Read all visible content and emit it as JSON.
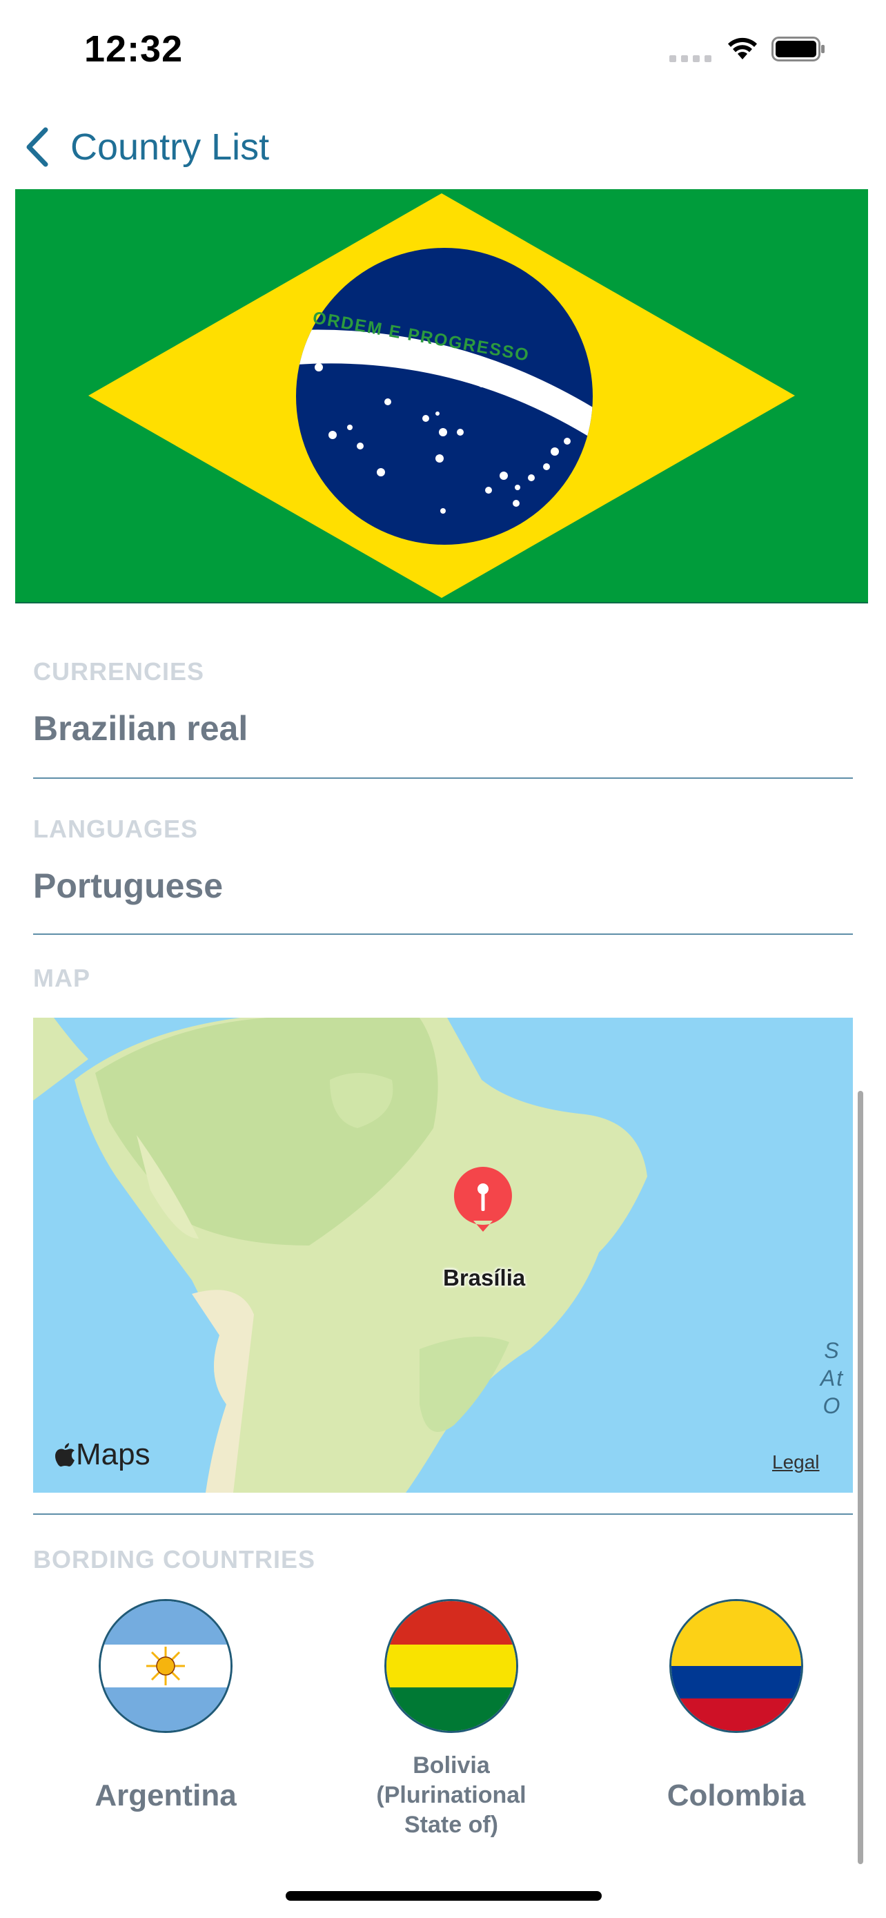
{
  "status_bar": {
    "time": "12:32"
  },
  "nav": {
    "back_label": "Country List"
  },
  "flag": {
    "motto": "ORDEM E PROGRESSO",
    "colors": {
      "green": "#009c3b",
      "yellow": "#ffdf00",
      "blue": "#002776"
    }
  },
  "currencies": {
    "label": "CURRENCIES",
    "value": "Brazilian real"
  },
  "languages": {
    "label": "LANGUAGES",
    "value": "Portuguese"
  },
  "map": {
    "label": "MAP",
    "pin_label": "Brasília",
    "brand": "Maps",
    "legal": "Legal",
    "ocean_letters": [
      "S",
      "At",
      "O"
    ]
  },
  "bordering": {
    "label": "BORDING COUNTRIES",
    "countries": [
      {
        "name": "Argentina",
        "flag_icon": "argentina-flag"
      },
      {
        "name": "Bolivia (Plurinational State of)",
        "name_lines": [
          "Bolivia",
          "(Plurinational",
          "State of)"
        ],
        "flag_icon": "bolivia-flag"
      },
      {
        "name": "Colombia",
        "flag_icon": "colombia-flag"
      }
    ]
  },
  "colors": {
    "accent": "#1f6f96",
    "section_label": "#cfd6dd",
    "value_text": "#6d7986",
    "divider": "#5e8ea8",
    "ocean": "#8fd4f5",
    "pin": "#f4454a"
  }
}
